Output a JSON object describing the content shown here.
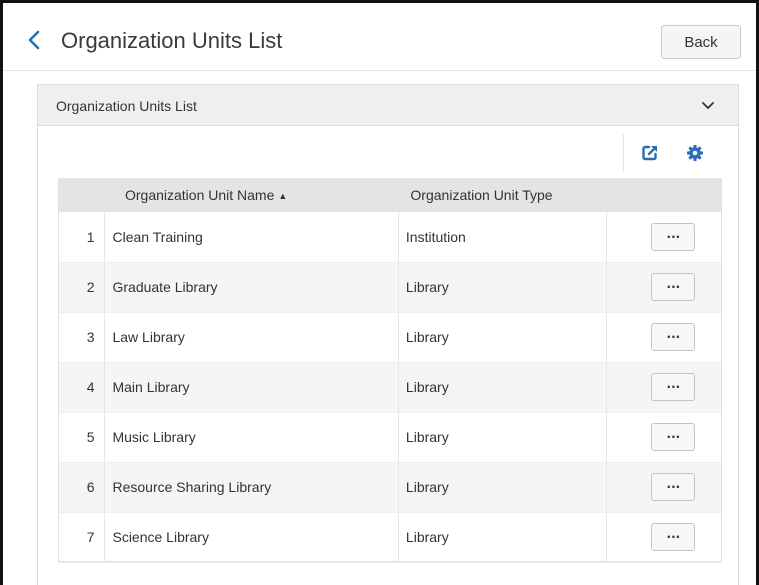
{
  "header": {
    "title": "Organization Units List",
    "back_label": "Back"
  },
  "panel": {
    "title": "Organization Units List",
    "toolbar": {
      "export_icon": "export-icon",
      "settings_icon": "gear-icon"
    }
  },
  "table": {
    "columns": {
      "name": "Organization Unit Name",
      "type": "Organization Unit Type"
    },
    "sort": {
      "column": "name",
      "direction": "ascending",
      "glyph": "▲"
    },
    "action_label": "···",
    "rows": [
      {
        "index": "1",
        "name": "Clean Training",
        "type": "Institution"
      },
      {
        "index": "2",
        "name": "Graduate Library",
        "type": "Library"
      },
      {
        "index": "3",
        "name": "Law Library",
        "type": "Library"
      },
      {
        "index": "4",
        "name": "Main Library",
        "type": "Library"
      },
      {
        "index": "5",
        "name": "Music Library",
        "type": "Library"
      },
      {
        "index": "6",
        "name": "Resource Sharing Library",
        "type": "Library"
      },
      {
        "index": "7",
        "name": "Science Library",
        "type": "Library"
      }
    ]
  },
  "colors": {
    "accent": "#2a6eb5",
    "header_bg": "#efefef",
    "table_header_bg": "#e4e4e4",
    "row_alt_bg": "#f5f5f5"
  }
}
